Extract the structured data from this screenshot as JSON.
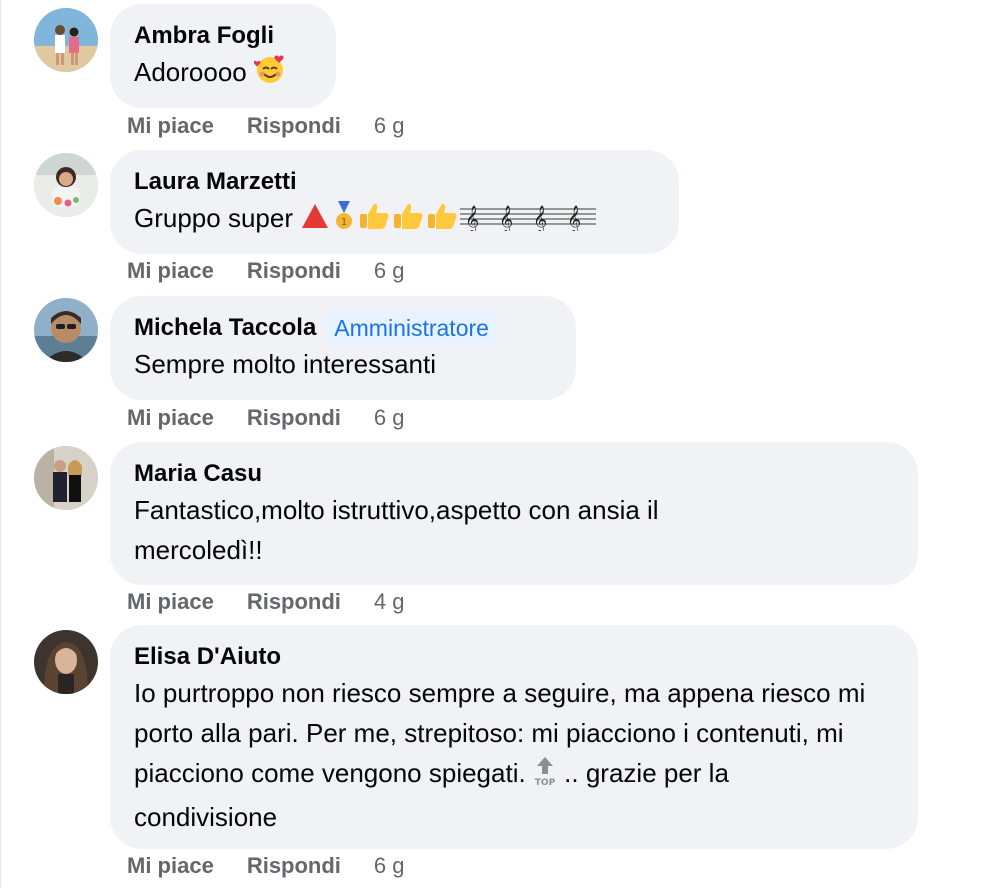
{
  "comments": [
    {
      "author": "Ambra Fogli",
      "badge": "",
      "text": "Adoroooo",
      "emoji_after": "smiling-face-with-hearts",
      "like": "Mi piace",
      "reply": "Rispondi",
      "time": "6 g"
    },
    {
      "author": "Laura Marzetti",
      "badge": "",
      "text": "Gruppo super",
      "emoji_after": "triangle, medal, thumbs-up x3, treble-clef x4",
      "like": "Mi piace",
      "reply": "Rispondi",
      "time": "6 g"
    },
    {
      "author": "Michela Taccola",
      "badge": "Amministratore",
      "text": "Sempre molto interessanti",
      "like": "Mi piace",
      "reply": "Rispondi",
      "time": "6 g"
    },
    {
      "author": "Maria Casu",
      "badge": "",
      "text": "Fantastico,molto istruttivo,aspetto con ansia il mercoledì!!",
      "like": "Mi piace",
      "reply": "Rispondi",
      "time": "4 g"
    },
    {
      "author": "Elisa D'Aiuto",
      "badge": "",
      "text_before_emoji": "Io purtroppo non riesco sempre a seguire, ma appena riesco mi porto alla pari. Per me, strepitoso: mi piacciono i contenuti, mi piacciono come vengono spiegati.",
      "text_after_emoji": ".. grazie per la condivisione",
      "inline_emoji": "top-arrow",
      "like": "Mi piace",
      "reply": "Rispondi",
      "time": "6 g"
    }
  ],
  "colors": {
    "bubble": "#f0f2f5",
    "meta": "#65676b",
    "badge_text": "#1b74e4",
    "badge_bg": "#e7f3ff"
  }
}
